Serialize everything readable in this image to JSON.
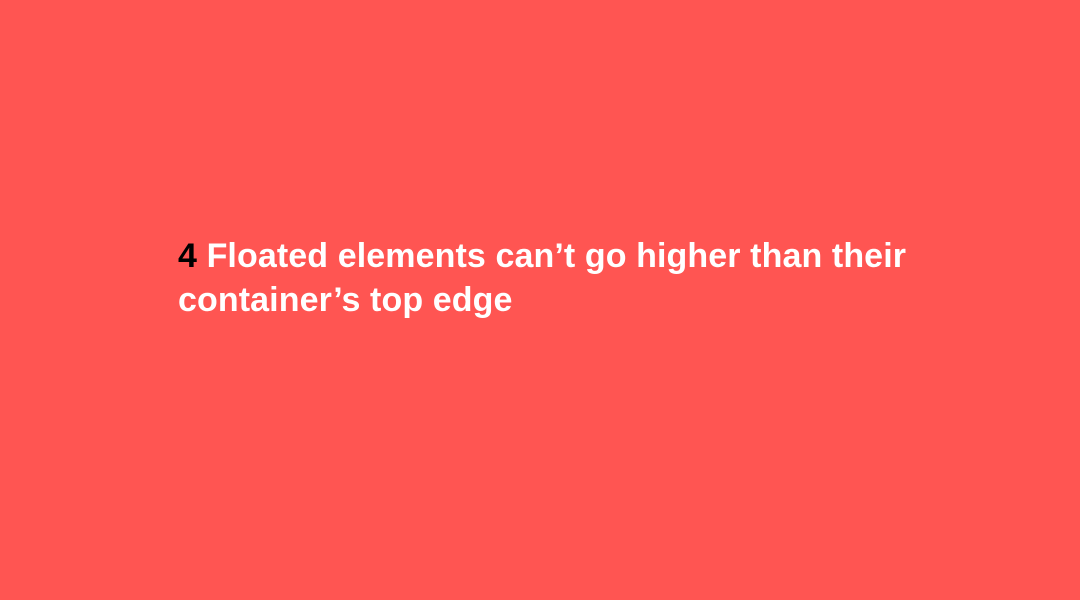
{
  "slide": {
    "number": "4",
    "title": "Floated elements can’t go higher than their container’s top edge"
  },
  "colors": {
    "background": "#ff5552",
    "number": "#000000",
    "title": "#ffffff"
  }
}
